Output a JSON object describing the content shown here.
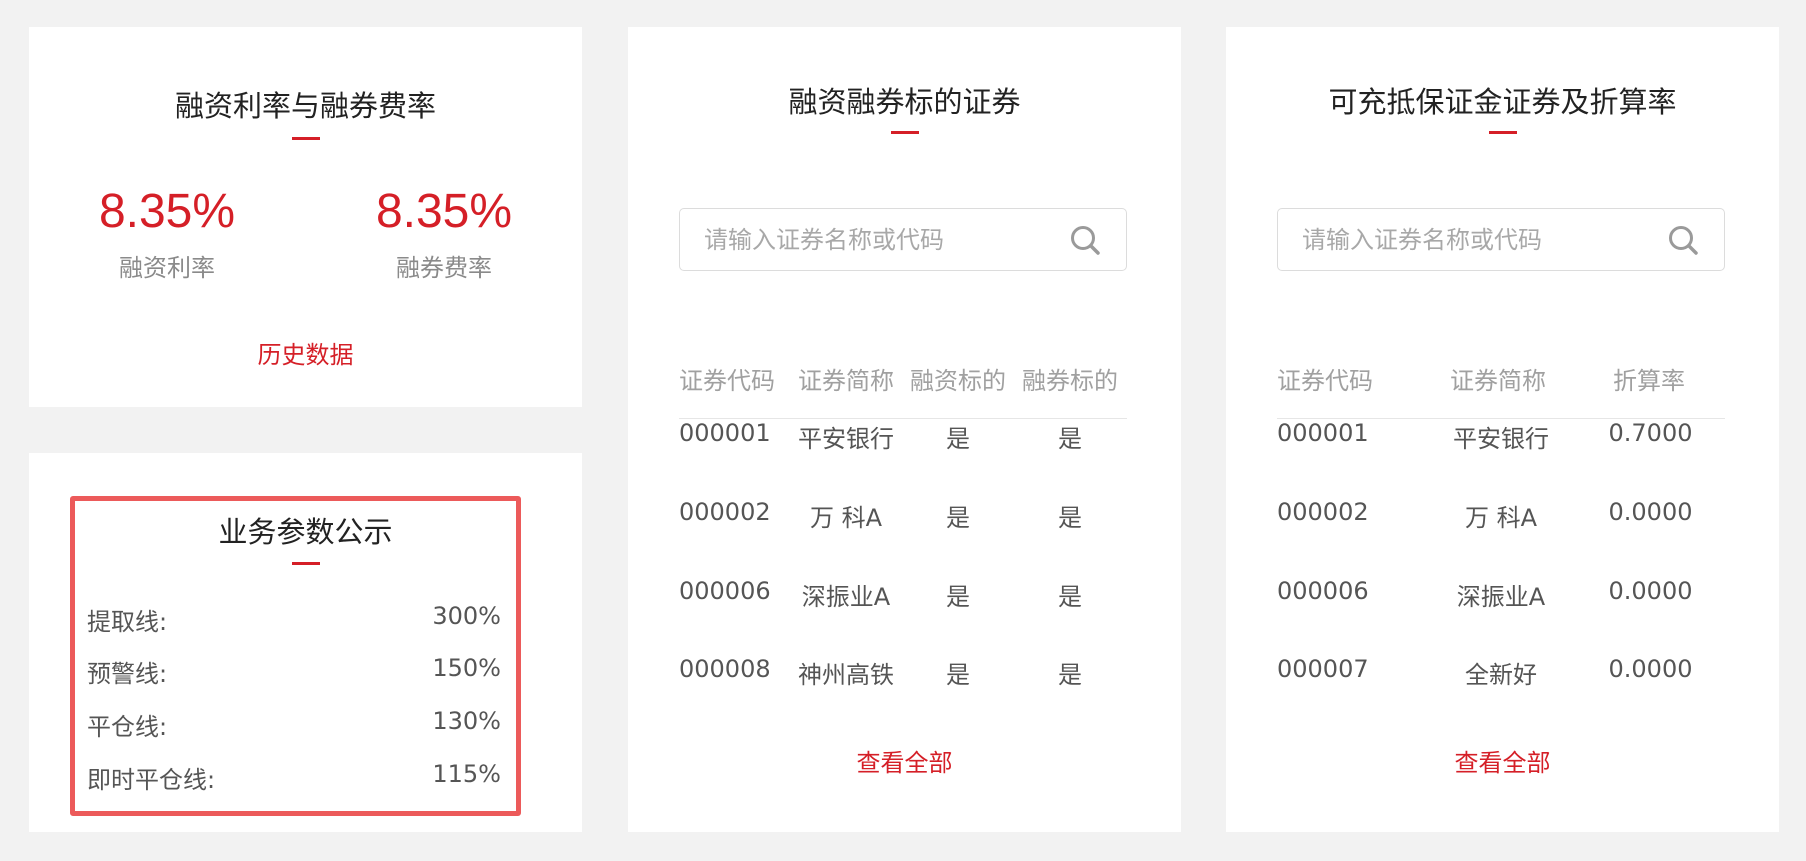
{
  "rates": {
    "title": "融资利率与融券费率",
    "financing_rate": "8.35%",
    "financing_label": "融资利率",
    "lending_rate": "8.35%",
    "lending_label": "融券费率",
    "history_link": "历史数据"
  },
  "params": {
    "title": "业务参数公示",
    "rows": [
      {
        "label": "提取线:",
        "value": "300%"
      },
      {
        "label": "预警线:",
        "value": "150%"
      },
      {
        "label": "平仓线:",
        "value": "130%"
      },
      {
        "label": "即时平仓线:",
        "value": "115%"
      }
    ]
  },
  "margin_securities": {
    "title": "融资融券标的证券",
    "search_placeholder": "请输入证券名称或代码",
    "columns": [
      "证券代码",
      "证券简称",
      "融资标的",
      "融券标的"
    ],
    "rows": [
      [
        "000001",
        "平安银行",
        "是",
        "是"
      ],
      [
        "000002",
        "万 科A",
        "是",
        "是"
      ],
      [
        "000006",
        "深振业A",
        "是",
        "是"
      ],
      [
        "000008",
        "神州高铁",
        "是",
        "是"
      ]
    ],
    "view_all": "查看全部"
  },
  "collateral": {
    "title": "可充抵保证金证券及折算率",
    "search_placeholder": "请输入证券名称或代码",
    "columns": [
      "证券代码",
      "证券简称",
      "折算率"
    ],
    "rows": [
      [
        "000001",
        "平安银行",
        "0.7000"
      ],
      [
        "000002",
        "万 科A",
        "0.0000"
      ],
      [
        "000006",
        "深振业A",
        "0.0000"
      ],
      [
        "000007",
        "全新好",
        "0.0000"
      ]
    ],
    "view_all": "查看全部"
  },
  "colors": {
    "accent_red": "#d51f27",
    "highlight_border": "#ec5a5a",
    "background": "#f2f2f2"
  }
}
